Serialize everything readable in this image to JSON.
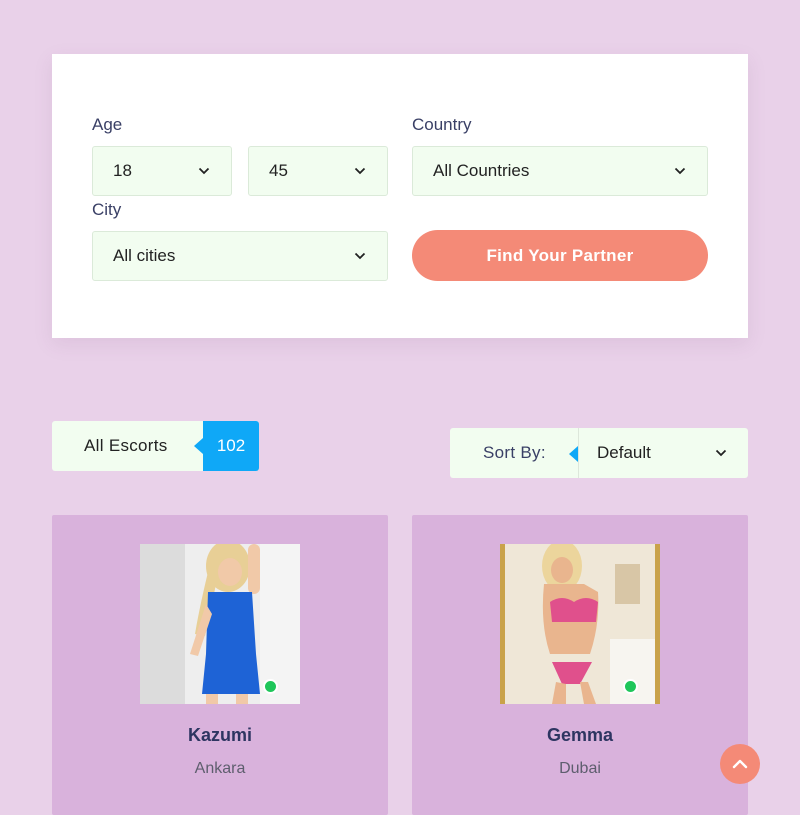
{
  "filters": {
    "age_label": "Age",
    "age_min": "18",
    "age_max": "45",
    "country_label": "Country",
    "country_value": "All Countries",
    "city_label": "City",
    "city_value": "All cities",
    "submit_label": "Find Your Partner"
  },
  "results": {
    "count_label": "All Escorts",
    "count_value": "102",
    "sort_label": "Sort By:",
    "sort_value": "Default"
  },
  "profiles": [
    {
      "name": "Kazumi",
      "city": "Ankara",
      "online": true,
      "outfit_color": "#1e63d6"
    },
    {
      "name": "Gemma",
      "city": "Dubai",
      "online": true,
      "outfit_color": "#e0508c"
    }
  ],
  "colors": {
    "page_bg": "#e9d1e9",
    "accent": "#f48a77",
    "badge": "#0fa8f7",
    "card_bg": "#d9b2dc",
    "field_bg": "#f2fdf0",
    "online": "#1fc65a"
  },
  "icons": {
    "dropdown": "chevron-down-icon",
    "scroll_top": "chevron-up-icon",
    "status": "online-dot-icon"
  }
}
